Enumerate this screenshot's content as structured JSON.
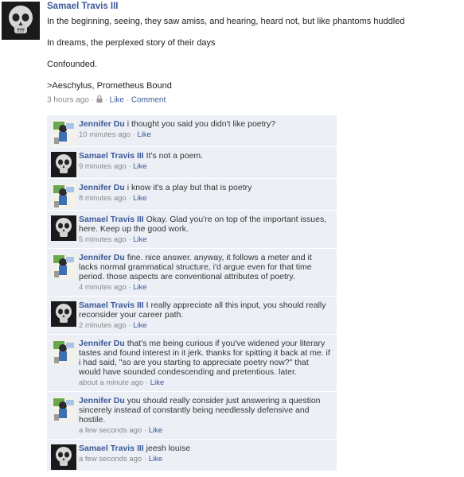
{
  "post": {
    "author": "Samael Travis III",
    "lines": [
      "In the beginning, seeing, they saw amiss, and hearing, heard not, but like phantoms huddled",
      "In dreams, the perplexed story of their days",
      "Confounded.",
      ">Aeschylus, Prometheus Bound"
    ],
    "time": "3 hours ago",
    "separator": "·",
    "like_label": "Like",
    "comment_label": "Comment"
  },
  "comments": [
    {
      "author": "Jennifer Du",
      "text": "i thought you said you didn't like poetry?",
      "time": "10 minutes ago",
      "like": "Like",
      "avatar": "jennifer"
    },
    {
      "author": "Samael Travis III",
      "text": "It's not a poem.",
      "time": "9 minutes ago",
      "like": "Like",
      "avatar": "samael"
    },
    {
      "author": "Jennifer Du",
      "text": "i know it's a play but that is poetry",
      "time": "8 minutes ago",
      "like": "Like",
      "avatar": "jennifer"
    },
    {
      "author": "Samael Travis III",
      "text": "Okay. Glad you're on top of the important issues, here. Keep up the good work.",
      "time": "5 minutes ago",
      "like": "Like",
      "avatar": "samael"
    },
    {
      "author": "Jennifer Du",
      "text": "fine. nice answer. anyway, it follows a meter and it lacks normal grammatical structure, i'd argue even for that time period. those aspects are conventional attributes of poetry.",
      "time": "4 minutes ago",
      "like": "Like",
      "avatar": "jennifer"
    },
    {
      "author": "Samael Travis III",
      "text": "I really appreciate all this input, you should really reconsider your career path.",
      "time": "2 minutes ago",
      "like": "Like",
      "avatar": "samael"
    },
    {
      "author": "Jennifer Du",
      "text": "that's me being curious if you've widened your literary tastes and found interest in it jerk. thanks for spitting it back at me. if i had said, \"so are you starting to appreciate poetry now?\" that would have sounded condescending and pretentious. later.",
      "time": "about a minute ago",
      "like": "Like",
      "avatar": "jennifer"
    },
    {
      "author": "Jennifer Du",
      "text": "you should really consider just answering a question sincerely instead of constantly being needlessly defensive and hostile.",
      "time": "a few seconds ago",
      "like": "Like",
      "avatar": "jennifer"
    },
    {
      "author": "Samael Travis III",
      "text": "jeesh louise",
      "time": "a few seconds ago",
      "like": "Like",
      "avatar": "samael"
    }
  ]
}
